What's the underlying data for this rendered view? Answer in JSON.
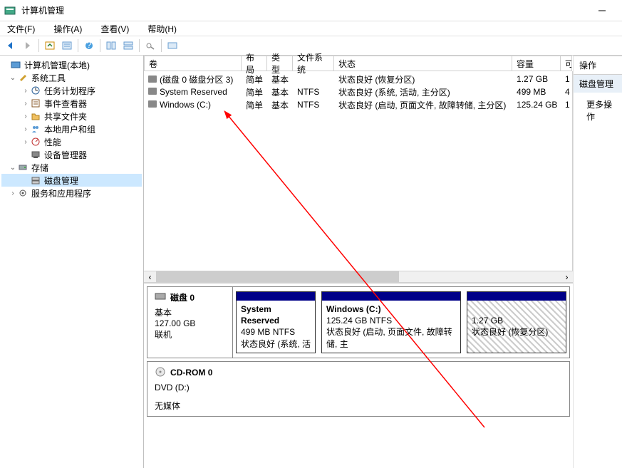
{
  "titlebar": {
    "title": "计算机管理"
  },
  "menu": {
    "file": "文件(F)",
    "action": "操作(A)",
    "view": "查看(V)",
    "help": "帮助(H)"
  },
  "tree": {
    "root": "计算机管理(本地)",
    "systools": "系统工具",
    "scheduler": "任务计划程序",
    "eventviewer": "事件查看器",
    "sharedfolders": "共享文件夹",
    "localusers": "本地用户和组",
    "perf": "性能",
    "devmgr": "设备管理器",
    "storage": "存储",
    "diskmgmt": "磁盘管理",
    "services": "服务和应用程序"
  },
  "table": {
    "headers": {
      "vol": "卷",
      "layout": "布局",
      "type": "类型",
      "fs": "文件系统",
      "status": "状态",
      "cap": "容量",
      "free": "可"
    },
    "rows": [
      {
        "vol": "(磁盘 0 磁盘分区 3)",
        "layout": "简单",
        "type": "基本",
        "fs": "",
        "status": "状态良好 (恢复分区)",
        "cap": "1.27 GB",
        "free": "1"
      },
      {
        "vol": "System Reserved",
        "layout": "简单",
        "type": "基本",
        "fs": "NTFS",
        "status": "状态良好 (系统, 活动, 主分区)",
        "cap": "499 MB",
        "free": "4"
      },
      {
        "vol": "Windows (C:)",
        "layout": "简单",
        "type": "基本",
        "fs": "NTFS",
        "status": "状态良好 (启动, 页面文件, 故障转储, 主分区)",
        "cap": "125.24 GB",
        "free": "1"
      }
    ]
  },
  "diskmap": {
    "disk0": {
      "name": "磁盘 0",
      "type": "基本",
      "size": "127.00 GB",
      "status": "联机",
      "parts": [
        {
          "name": "System Reserved",
          "size": "499 MB NTFS",
          "status": "状态良好 (系统, 活"
        },
        {
          "name": "Windows  (C:)",
          "size": "125.24 GB NTFS",
          "status": "状态良好 (启动, 页面文件, 故障转储, 主"
        },
        {
          "name": "",
          "size": "1.27 GB",
          "status": "状态良好 (恢复分区)"
        }
      ]
    },
    "cdrom": {
      "name": "CD-ROM 0",
      "type": "DVD (D:)",
      "status": "无媒体"
    }
  },
  "actions": {
    "header": "操作",
    "section": "磁盘管理",
    "more": "更多操作"
  }
}
